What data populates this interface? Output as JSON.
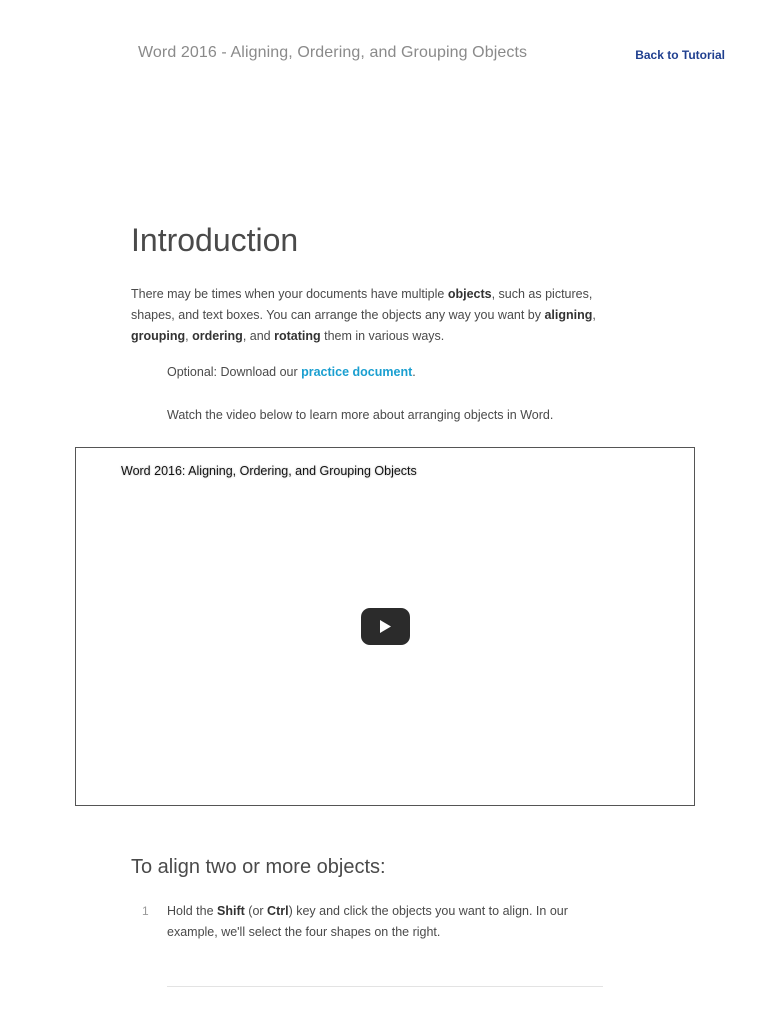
{
  "header": {
    "title": "Word 2016 - Aligning, Ordering, and Grouping Objects",
    "back_link": "Back to Tutorial"
  },
  "intro": {
    "heading": "Introduction",
    "paragraph": {
      "p1": "There may be times when your documents have multiple ",
      "b1": "objects",
      "p2": ", such as pictures, shapes, and text boxes. You can arrange the objects any way you want by ",
      "b2": "aligning",
      "p3": ", ",
      "b3": "grouping",
      "p4": ", ",
      "b4": "ordering",
      "p5": ", and ",
      "b5": "rotating",
      "p6": " them in various ways."
    },
    "optional_prefix": "Optional: Download our ",
    "optional_link": "practice document",
    "optional_suffix": ".",
    "watch_text": "Watch the video below to learn more about arranging objects in Word."
  },
  "video": {
    "title": "Word 2016: Aligning, Ordering, and Grouping Objects",
    "play_icon": "play-icon"
  },
  "section": {
    "heading": "To align two or more objects:",
    "steps": [
      {
        "number": "1",
        "t1": "Hold the ",
        "b1": "Shift",
        "t2": " (or ",
        "b2": "Ctrl",
        "t3": ") key and click the objects you want to align. In our example, we'll select the four shapes on the right."
      }
    ]
  },
  "colors": {
    "link_accent": "#1a9fd0",
    "back_link": "#1f3f8f",
    "header_text": "#8a8a8a"
  }
}
